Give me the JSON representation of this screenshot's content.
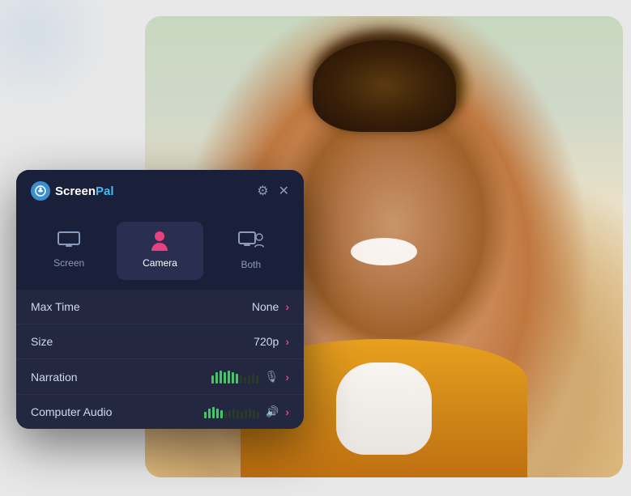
{
  "app": {
    "title": "ScreenPal",
    "logo_screen": "Screen",
    "logo_pal": "Pal"
  },
  "header": {
    "settings_icon": "⚙",
    "close_icon": "✕"
  },
  "modes": [
    {
      "id": "screen",
      "label": "Screen",
      "icon": "screen",
      "active": false
    },
    {
      "id": "camera",
      "label": "Camera",
      "icon": "camera",
      "active": true
    },
    {
      "id": "both",
      "label": "Both",
      "icon": "both",
      "active": false
    }
  ],
  "settings": [
    {
      "id": "max-time",
      "label": "Max Time",
      "value": "None",
      "has_chevron": true
    },
    {
      "id": "size",
      "label": "Size",
      "value": "720p",
      "has_chevron": true
    },
    {
      "id": "narration",
      "label": "Narration",
      "value": "",
      "has_bars": true,
      "bar_count": 12,
      "active_bars": 7,
      "icon": "mic",
      "has_chevron": true
    },
    {
      "id": "computer-audio",
      "label": "Computer Audio",
      "value": "",
      "has_bars": true,
      "bar_count": 14,
      "active_bars": 5,
      "icon": "speaker",
      "has_chevron": true
    }
  ],
  "colors": {
    "accent": "#e84080",
    "panel_bg": "#1a1f3a",
    "settings_bg": "#232840",
    "text_primary": "#d0d8f0",
    "icon_color": "#8a9abc",
    "bar_active": "#44c866",
    "bar_inactive": "#2a4030"
  }
}
